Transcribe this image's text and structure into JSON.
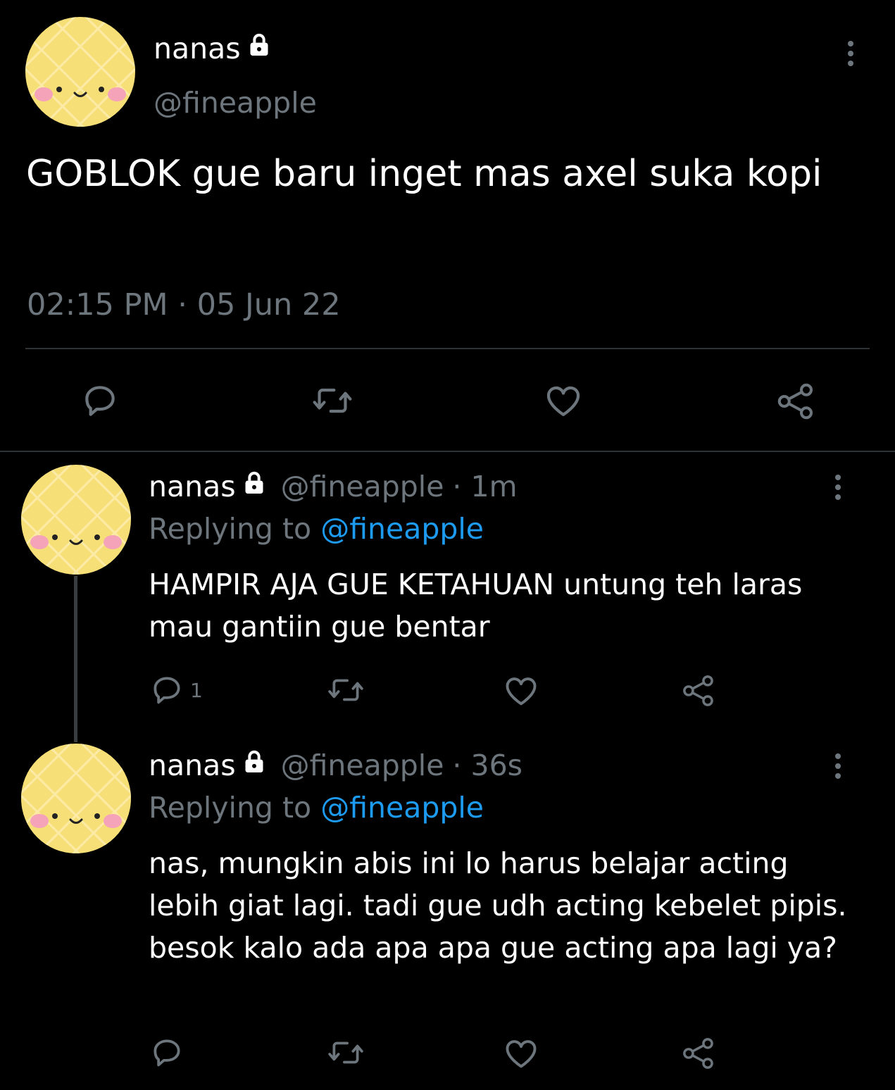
{
  "main_tweet": {
    "name": "nanas",
    "handle": "@fineapple",
    "text": "GOBLOK gue baru inget mas axel suka kopi",
    "timestamp": "02:15 PM · 05 Jun 22",
    "actions": [
      "reply-icon",
      "retweet-icon",
      "like-icon",
      "share-icon"
    ]
  },
  "replies": [
    {
      "name": "nanas",
      "handle": "@fineapple",
      "time": "· 1m",
      "replying_prefix": "Replying to",
      "replying_to": "@fineapple",
      "text": "HAMPIR AJA GUE KETAHUAN untung teh laras mau gantiin gue bentar",
      "reply_count": "1"
    },
    {
      "name": "nanas",
      "handle": "@fineapple",
      "time": "· 36s",
      "replying_prefix": "Replying to",
      "replying_to": "@fineapple",
      "text": "nas, mungkin abis ini lo harus belajar acting lebih giat lagi. tadi gue udh acting kebelet pipis. besok kalo ada apa apa gue acting apa lagi ya?",
      "reply_count": ""
    }
  ],
  "colors": {
    "background": "#000000",
    "text": "#ffffff",
    "muted": "#6e767d",
    "link": "#1d9bf0",
    "avatar": "#f7df78",
    "divider": "#2f3336"
  }
}
